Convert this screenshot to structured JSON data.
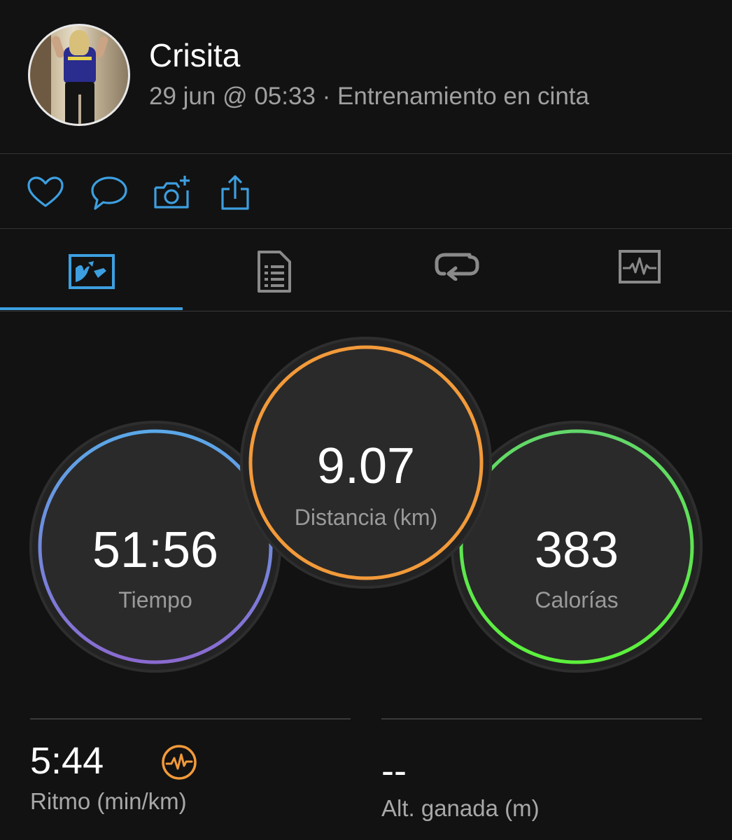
{
  "header": {
    "name": "Crisita",
    "subtitle": "29 jun @ 05:33 · Entrenamiento en cinta"
  },
  "actions": {
    "icons": [
      "heart-icon",
      "comment-icon",
      "add-photo-icon",
      "share-icon"
    ]
  },
  "tabs": {
    "icons": [
      "stats-overview-icon",
      "details-list-icon",
      "laps-icon",
      "heart-rate-chart-icon"
    ],
    "active_index": 0
  },
  "stats": {
    "time": {
      "value": "51:56",
      "label": "Tiempo"
    },
    "distance": {
      "value": "9.07",
      "label": "Distancia (km)"
    },
    "calories": {
      "value": "383",
      "label": "Calorías"
    }
  },
  "metrics": {
    "pace": {
      "value": "5:44",
      "label": "Ritmo (min/km)"
    },
    "elevation": {
      "value": "--",
      "label": "Alt. ganada (m)"
    }
  },
  "colors": {
    "accent": "#3d9fe0",
    "time_ring_start": "#5aa8e8",
    "time_ring_end": "#8a6ad0",
    "distance_ring": "#f29a3a",
    "calories_ring_start": "#62d66a",
    "calories_ring_end": "#5cf13c",
    "pace_icon": "#f29a3a"
  }
}
